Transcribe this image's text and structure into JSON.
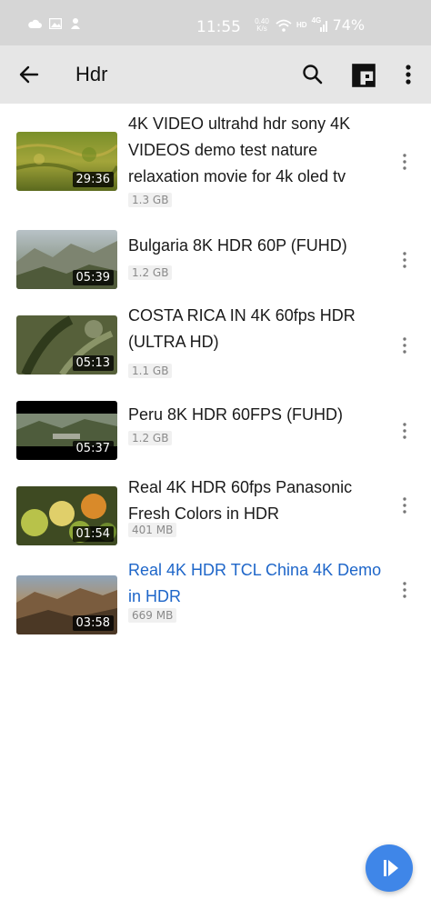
{
  "status_bar": {
    "time": "11:55",
    "net_speed_top": "0.40",
    "net_speed_bottom": "K/s",
    "hd": "HD",
    "network": "4G",
    "battery": "74%"
  },
  "app_bar": {
    "title": "Hdr"
  },
  "videos": [
    {
      "title": "4K VIDEO ultrahd hdr sony 4K VIDEOS demo test nature relaxation movie for 4k oled tv",
      "duration": "29:36",
      "size": "1.3 GB",
      "active": false
    },
    {
      "title": "Bulgaria 8K HDR 60P (FUHD)",
      "duration": "05:39",
      "size": "1.2 GB",
      "active": false
    },
    {
      "title": "COSTA RICA IN 4K 60fps HDR (ULTRA HD)",
      "duration": "05:13",
      "size": "1.1 GB",
      "active": false
    },
    {
      "title": "Peru 8K HDR 60FPS (FUHD)",
      "duration": "05:37",
      "size": "1.2 GB",
      "active": false
    },
    {
      "title": "Real 4K HDR 60fps Panasonic Fresh Colors in HDR",
      "duration": "01:54",
      "size": "401 MB",
      "active": false
    },
    {
      "title": "Real 4K HDR TCL China 4K Demo in HDR",
      "duration": "03:58",
      "size": "669 MB",
      "active": true
    }
  ],
  "colors": {
    "accent": "#1e66c9",
    "fab": "#3f86e8",
    "app_bar_bg": "#e6e6e6",
    "status_bar_bg": "#d6d6d6"
  },
  "icons": {
    "back": "arrow-back-icon",
    "search": "search-icon",
    "layout": "grid-layout-icon",
    "more": "more-vert-icon",
    "fab": "play-icon"
  }
}
